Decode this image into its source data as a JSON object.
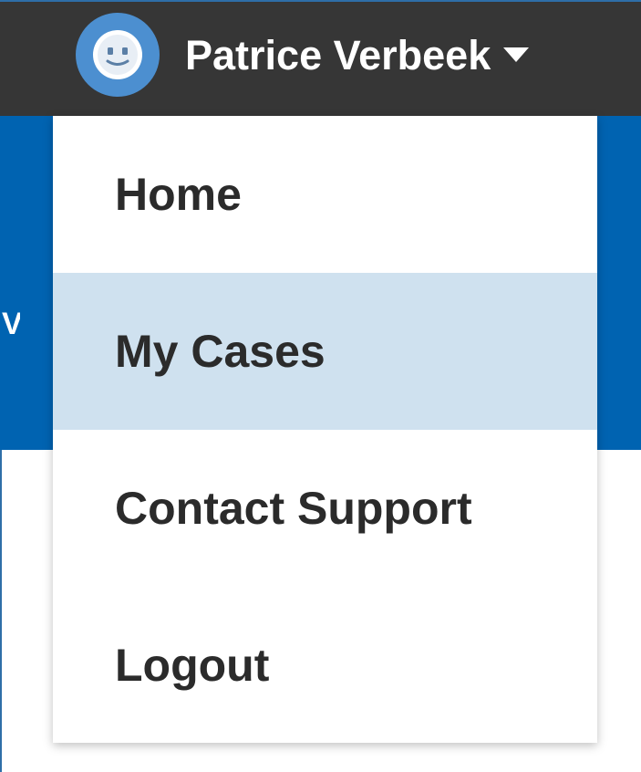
{
  "user": {
    "name": "Patrice Verbeek",
    "avatar_icon": "smiley-face-icon",
    "caret_icon": "caret-down-icon"
  },
  "menu": {
    "items": [
      {
        "label": "Home",
        "highlighted": false
      },
      {
        "label": "My Cases",
        "highlighted": true
      },
      {
        "label": "Contact Support",
        "highlighted": false
      },
      {
        "label": "Logout",
        "highlighted": false
      }
    ]
  },
  "colors": {
    "top_bar": "#363636",
    "brand_blue": "#0063b1",
    "avatar": "#4c8fd0",
    "highlight": "#cfe1ef",
    "menu_text": "#2b2b2b"
  }
}
